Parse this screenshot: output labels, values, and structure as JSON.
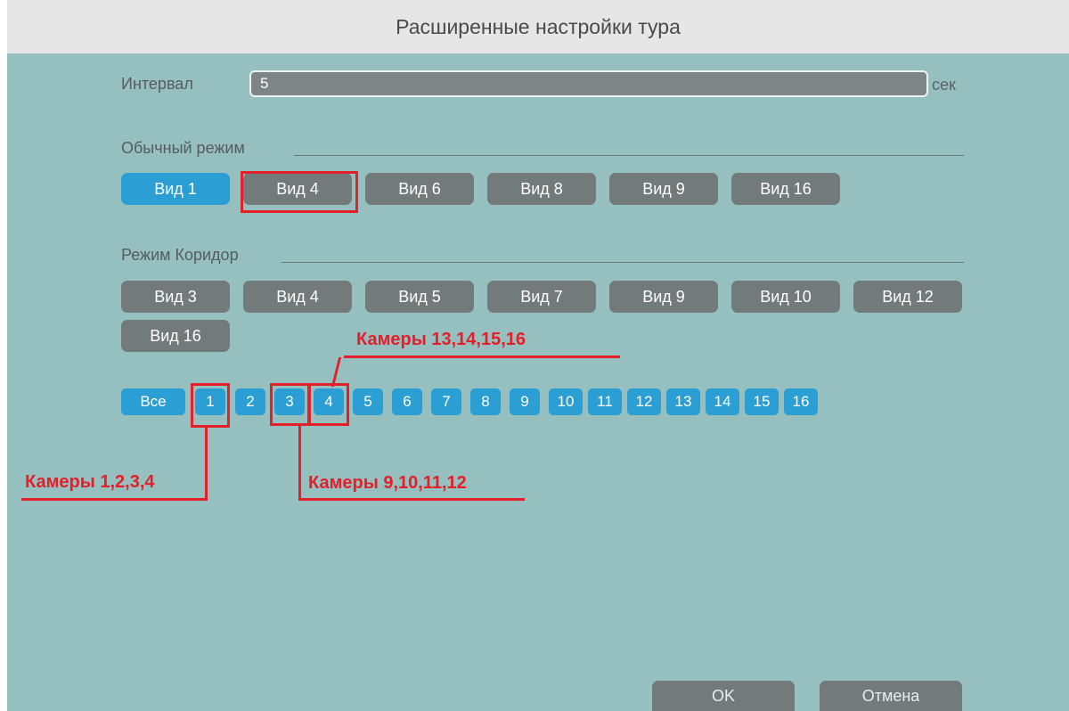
{
  "dialog": {
    "title": "Расширенные настройки тура"
  },
  "interval": {
    "label": "Интервал",
    "value": "5",
    "unit": "сек"
  },
  "normal_mode": {
    "label": "Обычный режим",
    "buttons": [
      "Вид 1",
      "Вид 4",
      "Вид 6",
      "Вид 8",
      "Вид 9",
      "Вид 16"
    ],
    "selected": "Вид 1"
  },
  "corridor_mode": {
    "label": "Режим Коридор",
    "buttons": [
      "Вид 3",
      "Вид 4",
      "Вид 5",
      "Вид 7",
      "Вид 9",
      "Вид 10",
      "Вид 12",
      "Вид 16"
    ]
  },
  "cameras": {
    "all_label": "Все",
    "items": [
      "1",
      "2",
      "3",
      "4",
      "5",
      "6",
      "7",
      "8",
      "9",
      "10",
      "11",
      "12",
      "13",
      "14",
      "15",
      "16"
    ]
  },
  "annotations": {
    "cams_1_4": "Камеры 1,2,3,4",
    "cams_9_12": "Камеры 9,10,11,12",
    "cams_13_16": "Камеры 13,14,15,16"
  },
  "footer": {
    "ok_label": "OK",
    "cancel_label": "Отмена"
  },
  "colors": {
    "accent": "#2b9fd3",
    "button": "#737b7a",
    "background": "#96bfbf",
    "annotation": "#e3202a"
  }
}
